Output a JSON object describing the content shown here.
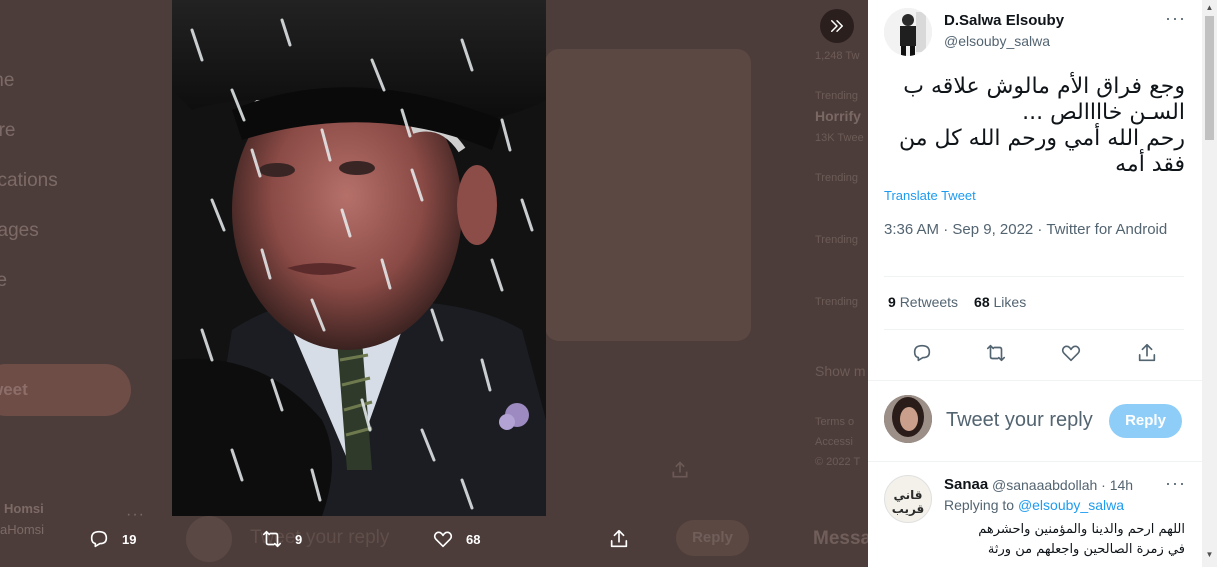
{
  "background": {
    "nav_items": [
      "me",
      "ore",
      "fications",
      "sages",
      "ile",
      "e"
    ],
    "tweet_button": "weet",
    "user_name": "Homsi",
    "user_handle": "aHomsi",
    "side_items": [
      "1,248 Tw",
      "Trending",
      "Horrify",
      "13K Twee",
      "Trending",
      "Trending",
      "Trending",
      "Show m",
      "Terms o",
      "Accessi",
      "© 2022 T"
    ],
    "messages": "Messa",
    "reply_placeholder": "Tweet your reply",
    "reply_button": "Reply"
  },
  "media_actions": {
    "replies": "19",
    "retweets": "9",
    "likes": "68"
  },
  "tweet": {
    "author_name": "D.Salwa Elsouby",
    "author_handle": "@elsouby_salwa",
    "text_lines": [
      "وجع فراق الأم مالوش علاقه ب",
      "السـن خاااالص ...",
      "رحم الله أمي ورحم الله كل من",
      "فقد أمه"
    ],
    "translate_label": "Translate Tweet",
    "meta": "3:36 AM · Sep 9, 2022 · Twitter for Android",
    "retweets_count": "9",
    "retweets_label": "Retweets",
    "likes_count": "68",
    "likes_label": "Likes"
  },
  "composer": {
    "placeholder": "Tweet your reply",
    "button": "Reply"
  },
  "reply": {
    "author_name": "Sanaa",
    "author_handle": "@sanaaabdollah · 14h",
    "replying_prefix": "Replying to",
    "replying_handle": "@elsouby_salwa",
    "text_lines": [
      "اللهم ارحم والدينا والمؤمنين واحشرهم",
      "في زمرة الصالحين واجعلهم من ورثة"
    ],
    "avatar_text": "قاني قريب"
  },
  "colors": {
    "accent": "#1d9bf0",
    "reply_button_disabled": "#8ecdf8",
    "overlay": "#4d3d3a"
  }
}
